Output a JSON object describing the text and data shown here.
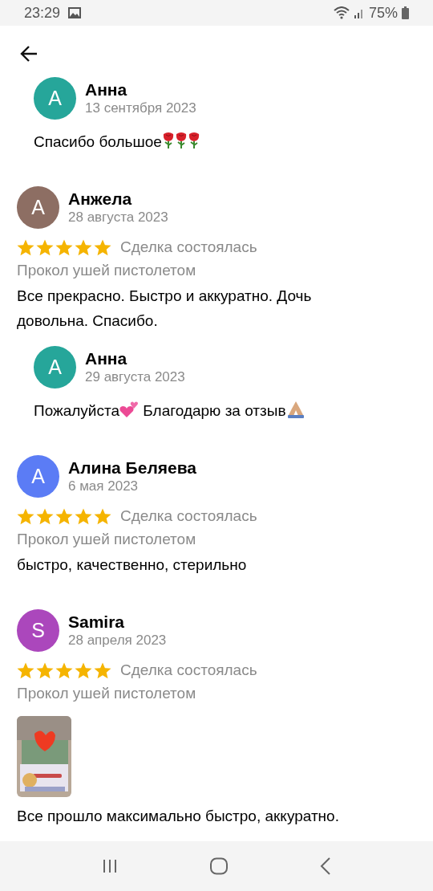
{
  "status_bar": {
    "time": "23:29",
    "battery": "75%"
  },
  "reviews": [
    {
      "kind": "reply",
      "author": "Анна",
      "initial": "А",
      "color": "#26a69a",
      "date": "13 сентября 2023",
      "text": [
        {
          "kind": "text",
          "value": "Спасибо большое"
        },
        {
          "kind": "rose"
        },
        {
          "kind": "rose"
        },
        {
          "kind": "rose"
        }
      ]
    },
    {
      "kind": "review",
      "author": "Анжела",
      "initial": "А",
      "color": "#8d6e63",
      "date": "28 августа 2023",
      "stars": 5,
      "status": "Сделка состоялась",
      "service": "Прокол ушей пистолетом",
      "text": [
        {
          "kind": "text",
          "value": "Все прекрасно. Быстро и аккуратно. Дочь довольна. Спасибо."
        }
      ]
    },
    {
      "kind": "reply",
      "author": "Анна",
      "initial": "А",
      "color": "#26a69a",
      "date": "29 августа 2023",
      "text": [
        {
          "kind": "text",
          "value": "Пожалуйста"
        },
        {
          "kind": "hearts"
        },
        {
          "kind": "text",
          "value": " Благодарю за отзыв"
        },
        {
          "kind": "pray"
        }
      ]
    },
    {
      "kind": "review",
      "author": "Алина Беляева",
      "initial": "А",
      "color": "#5b7cf5",
      "date": "6 мая 2023",
      "stars": 5,
      "status": "Сделка состоялась",
      "service": "Прокол ушей пистолетом",
      "text": [
        {
          "kind": "text",
          "value": "быстро, качественно, стерильно"
        }
      ]
    },
    {
      "kind": "review",
      "author": "Samira",
      "initial": "S",
      "color": "#ab47bc",
      "date": "28 апреля 2023",
      "stars": 5,
      "status": "Сделка состоялась",
      "service": "Прокол ушей пистолетом",
      "photos": [
        {
          "kind": "picture"
        }
      ],
      "text": [
        {
          "kind": "text",
          "value": "Все прошло максимально быстро, аккуратно."
        }
      ]
    }
  ]
}
